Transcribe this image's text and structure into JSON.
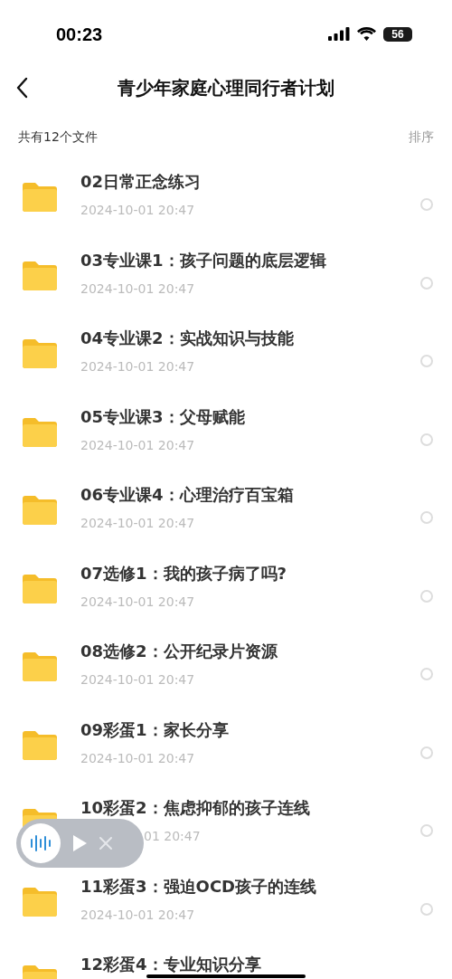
{
  "status_bar": {
    "time": "00:23",
    "battery": "56"
  },
  "nav": {
    "title": "青少年家庭心理同行者计划"
  },
  "summary": {
    "count": "共有12个文件",
    "sort": "排序"
  },
  "files": [
    {
      "name": "02日常正念练习",
      "date": "2024-10-01 20:47",
      "selected": false,
      "covered": false
    },
    {
      "name": "03专业课1：孩子问题的底层逻辑",
      "date": "2024-10-01 20:47",
      "selected": false,
      "covered": false
    },
    {
      "name": "04专业课2：实战知识与技能",
      "date": "2024-10-01 20:47",
      "selected": false,
      "covered": false
    },
    {
      "name": "05专业课3：父母赋能",
      "date": "2024-10-01 20:47",
      "selected": false,
      "covered": false
    },
    {
      "name": "06专业课4：心理治疗百宝箱",
      "date": "2024-10-01 20:47",
      "selected": false,
      "covered": false
    },
    {
      "name": "07选修1：我的孩子病了吗?",
      "date": "2024-10-01 20:47",
      "selected": false,
      "covered": false
    },
    {
      "name": "08选修2：公开纪录片资源",
      "date": "2024-10-01 20:47",
      "selected": false,
      "covered": false
    },
    {
      "name": "09彩蛋1：家长分享",
      "date": "2024-10-01 20:47",
      "selected": false,
      "covered": false
    },
    {
      "name": "10彩蛋2：焦虑抑郁的孩子连线",
      "date": "01 20:47",
      "selected": false,
      "covered": true
    },
    {
      "name": "11彩蛋3：强迫OCD孩子的连线",
      "date": "2024-10-01 20:47",
      "selected": false,
      "covered": false
    },
    {
      "name": "12彩蛋4：专业知识分享"
    }
  ]
}
